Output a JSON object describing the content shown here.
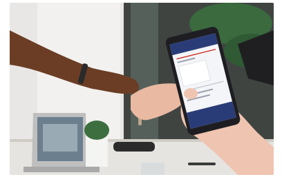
{
  "scene": {
    "description_visible": false
  },
  "phone_screen": {
    "header_title": "",
    "calendar_label": ""
  },
  "colors": {
    "wall_left": "#e8e6e4",
    "wall_right": "#3b3f3d",
    "table": "#e9e7e3",
    "phone_header": "#2a3c78",
    "phone_accent": "#d23a2f",
    "phone_body": "#1e1e22",
    "skin_dark": "#6b3d25",
    "skin_light": "#e9b9a2",
    "plant": "#3a6a3e"
  }
}
